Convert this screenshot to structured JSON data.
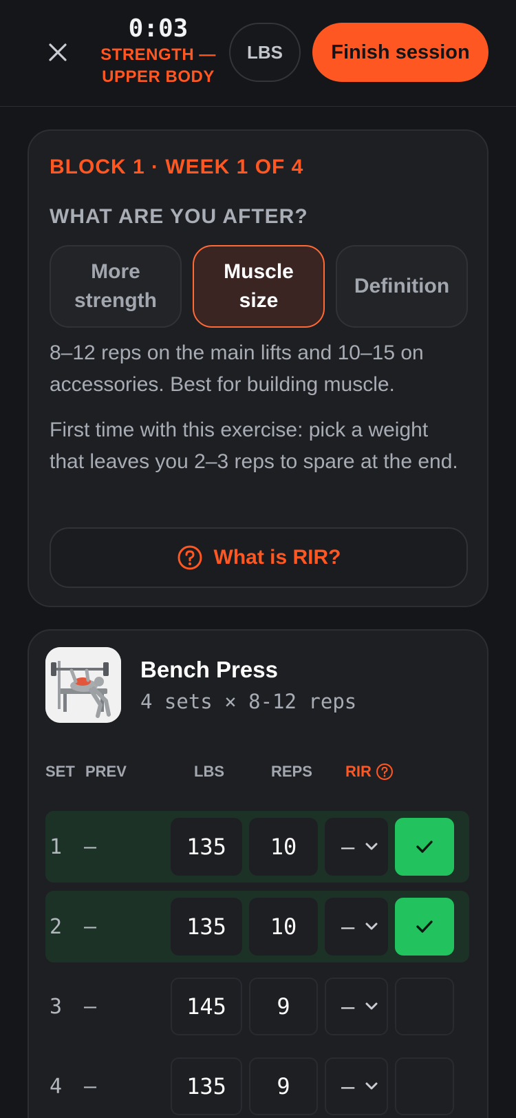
{
  "header": {
    "timer": "0:03",
    "workout_line1": "STRENGTH —",
    "workout_line2": "UPPER BODY",
    "unit_label": "LBS",
    "finish_label": "Finish session"
  },
  "program": {
    "block_label": "BLOCK 1 · WEEK 1 OF 4",
    "goal_question": "WHAT ARE YOU AFTER?",
    "goals": [
      {
        "label": "More strength",
        "selected": false
      },
      {
        "label": "Muscle size",
        "selected": true
      },
      {
        "label": "Definition",
        "selected": false
      }
    ],
    "goal_description": "8–12 reps on the main lifts and 10–15 on accessories. Best for building muscle.",
    "first_time_tip": "First time with this exercise: pick a weight that leaves you 2–3 reps to spare at the end.",
    "rir_help_label": "What is RIR?"
  },
  "exercise": {
    "name": "Bench Press",
    "meta": "4 sets × 8-12 reps",
    "columns": {
      "set": "SET",
      "prev": "PREV",
      "lbs": "LBS",
      "reps": "REPS",
      "rir": "RIR"
    },
    "sets": [
      {
        "num": "1",
        "prev": "–",
        "lbs": "135",
        "reps": "10",
        "rir": "–",
        "done": true
      },
      {
        "num": "2",
        "prev": "–",
        "lbs": "135",
        "reps": "10",
        "rir": "–",
        "done": true
      },
      {
        "num": "3",
        "prev": "–",
        "lbs": "145",
        "reps": "9",
        "rir": "–",
        "done": false
      },
      {
        "num": "4",
        "prev": "–",
        "lbs": "135",
        "reps": "9",
        "rir": "–",
        "done": false
      }
    ]
  },
  "colors": {
    "accent": "#ff5722",
    "done_green": "#22c35e",
    "done_row": "#1c3226"
  },
  "icons": [
    "close-icon",
    "help-circle-icon",
    "chevron-down-icon",
    "check-icon"
  ]
}
